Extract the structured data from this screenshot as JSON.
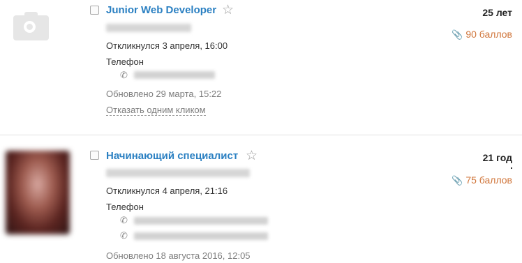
{
  "candidates": [
    {
      "title": "Junior Web Developer",
      "age": "25 лет",
      "points": "90 баллов",
      "responded": "Откликнулся 3 апреля, 16:00",
      "phone_label": "Телефон",
      "updated": "Обновлено 29 марта, 15:22",
      "reject": "Отказать одним кликом",
      "photo": "camera-placeholder-icon",
      "accent": "#2b80c2"
    },
    {
      "title": "Начинающий специалист",
      "age": "21 год",
      "points": "75 баллов",
      "responded": "Откликнулся 4 апреля, 21:16",
      "phone_label": "Телефон",
      "updated": "Обновлено 18 августа 2016, 12:05",
      "photo": "candidate-photo",
      "accent": "#2b80c2"
    }
  ],
  "colors": {
    "link": "#2b80c2",
    "points": "#d0753a",
    "muted": "#7d7d7d",
    "divider": "#e2e2e2"
  },
  "icons": [
    "checkbox",
    "star-icon",
    "phone-icon",
    "paperclip-icon",
    "camera-icon"
  ]
}
